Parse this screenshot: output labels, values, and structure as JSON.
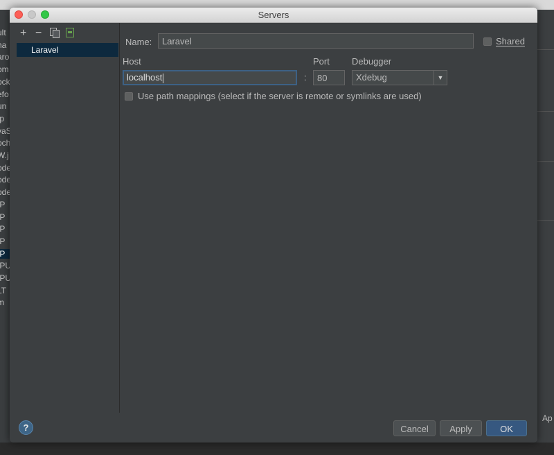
{
  "window": {
    "title": "Servers"
  },
  "background": {
    "left_fragments": [
      "ult",
      "ha",
      "aro",
      "om",
      "ock",
      "efo",
      "un",
      "Ip",
      "vaS",
      "och",
      "W.j",
      "ode",
      "ode",
      "ode",
      "IP",
      "IP",
      "IP",
      "IP",
      "IP",
      "IPU",
      "IPU",
      "LT",
      "m"
    ],
    "right_label": "Ap"
  },
  "toolbar": {
    "add": "+",
    "remove": "−"
  },
  "servers": [
    {
      "name": "Laravel"
    }
  ],
  "form": {
    "name_label": "Name:",
    "name_value": "Laravel",
    "shared_label": "Shared",
    "shared_checked": false,
    "host_label": "Host",
    "host_value": "localhost",
    "port_label": "Port",
    "port_separator": ":",
    "port_value": "80",
    "debugger_label": "Debugger",
    "debugger_value": "Xdebug",
    "path_mappings_label": "Use path mappings (select if the server is remote or symlinks are used)",
    "path_mappings_checked": false
  },
  "footer": {
    "help": "?",
    "cancel": "Cancel",
    "apply": "Apply",
    "ok": "OK"
  },
  "colors": {
    "selection": "#0d293e",
    "default_button": "#365880",
    "focus_ring": "#3d6185"
  }
}
